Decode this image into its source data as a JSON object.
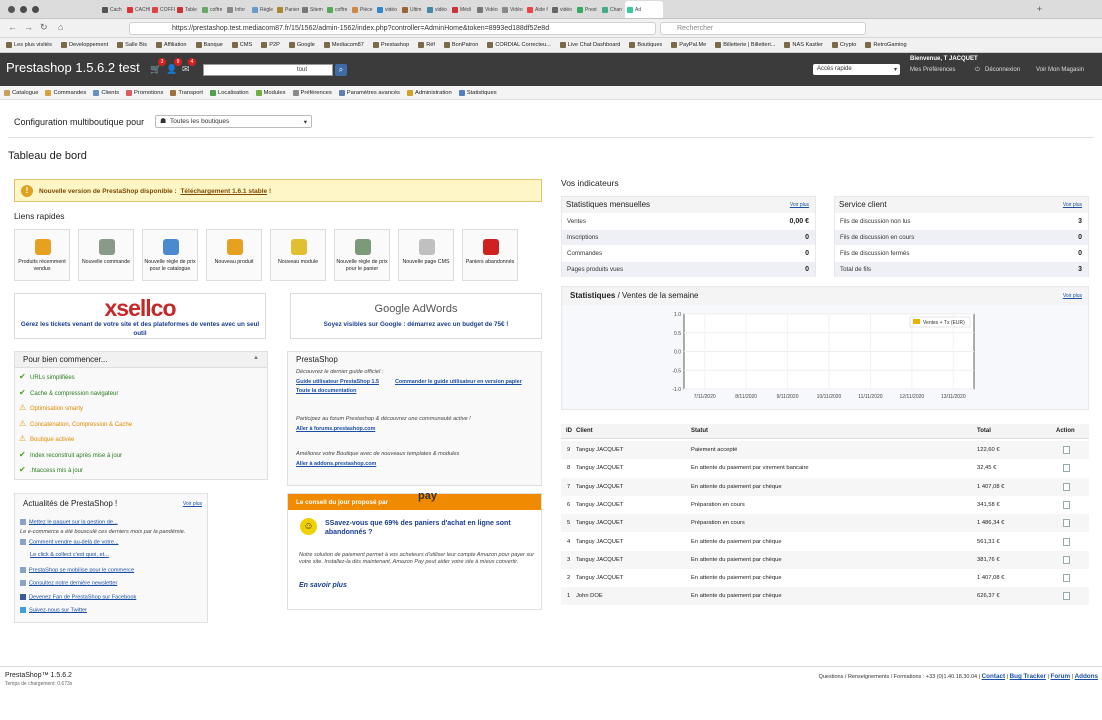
{
  "browser": {
    "tabs": [
      "Cach",
      "CACHE Cl",
      "COFFI",
      "Table",
      "coffre",
      "Infor",
      "Règle",
      "Panier",
      "Sitem",
      "coffre",
      "Pièce",
      "vidéo",
      "Ultim",
      "vidéo",
      "Médi",
      "Vidéo",
      "Vidéo",
      "Aide f",
      "vidéo",
      "Prest",
      "Chan",
      "Ad"
    ],
    "url": "https://prestashop.test.mediacom87.fr/15/1562/admin-1562/index.php?controller=AdminHome&token=8993ed188df52e8d",
    "search_placeholder": "Rechercher",
    "bookmarks": [
      "Les plus visités",
      "Developpement",
      "Salle Bis",
      "Affiliation",
      "Banque",
      "CMS",
      "P2P",
      "Google",
      "Mediacom87",
      "Prestashop",
      "Réf",
      "BonPatron",
      "CORDIAL Correcteu...",
      "Live Chat Dashboard",
      "Boutiques",
      "PayPal.Me",
      "Billetterie | Billetteri...",
      "NAS Kastler",
      "Crypto",
      "RetroGaming"
    ]
  },
  "header": {
    "title": "Prestashop 1.5.6.2 test",
    "cart_badges": [
      "3",
      "9",
      "4"
    ],
    "search_scope": "tout",
    "quick_access": "Accès rapide",
    "welcome": "Bienvenue, T JACQUET",
    "my_preferences": "Mes Préférences",
    "logout": "Déconnexion",
    "view_shop": "Voir Mon Magasin"
  },
  "menu": [
    {
      "label": "Catalogue",
      "color": "#c9a060"
    },
    {
      "label": "Commandes",
      "color": "#d8a040"
    },
    {
      "label": "Clients",
      "color": "#6a8fc0"
    },
    {
      "label": "Promotions",
      "color": "#d86060"
    },
    {
      "label": "Transport",
      "color": "#a07040"
    },
    {
      "label": "Localisation",
      "color": "#50a050"
    },
    {
      "label": "Modules",
      "color": "#70b040"
    },
    {
      "label": "Préférences",
      "color": "#8a8a8a"
    },
    {
      "label": "Paramètres avancés",
      "color": "#6080b0"
    },
    {
      "label": "Administration",
      "color": "#d0a030"
    },
    {
      "label": "Statistiques",
      "color": "#5080c0"
    }
  ],
  "config": {
    "label": "Configuration multiboutique pour",
    "shop": "Toutes les boutiques"
  },
  "page_title": "Tableau de bord",
  "alert": {
    "text": "Nouvelle version de PrestaShop disponible :",
    "link": "Téléchargement 1.6.1 stable",
    "suffix": "!"
  },
  "quick_links": {
    "title": "Liens rapides",
    "items": [
      {
        "label": "Produits récemment vendus",
        "color": "#e8a020"
      },
      {
        "label": "Nouvelle commande",
        "color": "#8a9a8a"
      },
      {
        "label": "Nouvelle règle de prix pour le catalogue",
        "color": "#4a8ad0"
      },
      {
        "label": "Nouveau produit",
        "color": "#e8a020"
      },
      {
        "label": "Nouveau module",
        "color": "#e0c030"
      },
      {
        "label": "Nouvelle règle de prix pour le panier",
        "color": "#7a9a7a"
      },
      {
        "label": "Nouvelle page CMS",
        "color": "#c0c0c0"
      },
      {
        "label": "Paniers abandonnés",
        "color": "#d02020"
      }
    ]
  },
  "xsellco": {
    "logo": "xsellco",
    "text": "Gérez les tickets venant de votre site et des plateformes de ventes avec un seul outil"
  },
  "adwords": {
    "logo": "Google AdWords",
    "text": "Soyez visibles sur Google : démarrez avec un budget de 75€ !"
  },
  "getting_started": {
    "title": "Pour bien commencer...",
    "items": [
      {
        "label": "URLs simplifiées",
        "status": "ok"
      },
      {
        "label": "Cache & compression navigateur",
        "status": "ok"
      },
      {
        "label": "Optimisation smarty",
        "status": "warn"
      },
      {
        "label": "Concaténation, Compression & Cache",
        "status": "warn"
      },
      {
        "label": "Boutique activée",
        "status": "warn"
      },
      {
        "label": "Index reconstruit après mise à jour",
        "status": "ok"
      },
      {
        "label": ".htaccess mis à jour",
        "status": "ok"
      }
    ]
  },
  "ps_box": {
    "title": "PrestaShop",
    "guide_text": "Découvrez le dernier guide officiel :",
    "guide_link1": "Guide utilisateur PrestaShop 1.5",
    "guide_link2": "Commander le guide utilisateur en version papier",
    "doc_link": "Toute la documentation",
    "forum_text": "Participez au forum Prestashop & découvrez une communauté active !",
    "forum_link": "Aller à forums.prestashop.com",
    "addons_text": "Améliorez votre Boutique avec de nouveaux templates & modules",
    "addons_link": "Aller à addons.prestashop.com"
  },
  "news": {
    "title": "Actualités de PrestaShop !",
    "more": "Voir plus",
    "link1": "Mettez le paquet sur la gestion de...",
    "text1": "Le e-commerce a été bousculé ces derniers mois par la pandémie.",
    "link2": "Comment vendre au-delà de votre...",
    "link3": "Le click & collect c'est quoi, et...",
    "link4": "PrestaShop se mobilise pour le commerce",
    "link5": "Consultez notre dernière newsletter",
    "link6": "Devenez Fan de PrestaShop sur Facebook",
    "link7": "Suivez-nous sur Twitter"
  },
  "tip": {
    "title": "Le conseil du jour proposé par",
    "brand": "pay",
    "main": "SSavez-vous que 69% des paniers d'achat en ligne sont abandonnés ?",
    "desc": "Notre solution de paiement permet à vos acheteurs d'utiliser leur compte Amazon pour payer sur votre site. Installez-la dès maintenant, Amazon Pay peut aider votre site à mieux convertir.",
    "more": "En savoir plus"
  },
  "indicators": {
    "title": "Vos indicateurs",
    "monthly": {
      "title": "Statistiques mensuelles",
      "more": "Voir plus",
      "rows": [
        {
          "label": "Ventes",
          "value": "0,00 €"
        },
        {
          "label": "Inscriptions",
          "value": "0"
        },
        {
          "label": "Commandes",
          "value": "0"
        },
        {
          "label": "Pages produits vues",
          "value": "0"
        }
      ]
    },
    "service": {
      "title": "Service client",
      "more": "Voir plus",
      "rows": [
        {
          "label": "Fils de discussion non lus",
          "value": "3"
        },
        {
          "label": "Fils de discussion en cours",
          "value": "0"
        },
        {
          "label": "Fils de discussion fermés",
          "value": "0"
        },
        {
          "label": "Total de fils",
          "value": "3"
        }
      ]
    }
  },
  "weekly": {
    "title_bold": "Statistiques",
    "title_rest": " / Ventes de la semaine",
    "more": "Voir plus"
  },
  "chart_data": {
    "type": "line",
    "title": "",
    "x": [
      "7/11/2020",
      "8/11/2020",
      "9/11/2020",
      "10/11/2020",
      "11/11/2020",
      "12/11/2020",
      "13/11/2020"
    ],
    "series": [
      {
        "name": "Ventes + Tx (EUR)",
        "values": [
          0,
          0,
          0,
          0,
          0,
          0,
          0
        ],
        "color": "#f0b000"
      }
    ],
    "ylim": [
      -1.0,
      1.0
    ],
    "yticks": [
      "1.0",
      "0.5",
      "0.0",
      "-0.5",
      "-1.0"
    ],
    "grid": true,
    "legend": "top-right"
  },
  "orders": {
    "headers": {
      "id": "ID",
      "client": "Client",
      "status": "Statut",
      "total": "Total",
      "action": "Action"
    },
    "rows": [
      {
        "id": "9",
        "client": "Tanguy JACQUET",
        "status": "Paiement accepté",
        "total": "122,60 €"
      },
      {
        "id": "8",
        "client": "Tanguy JACQUET",
        "status": "En attente du paiement par virement bancaire",
        "total": "32,45 €"
      },
      {
        "id": "7",
        "client": "Tanguy JACQUET",
        "status": "En attente du paiement par chèque",
        "total": "1 407,08 €"
      },
      {
        "id": "6",
        "client": "Tanguy JACQUET",
        "status": "Préparation en cours",
        "total": "341,58 €"
      },
      {
        "id": "5",
        "client": "Tanguy JACQUET",
        "status": "Préparation en cours",
        "total": "1 486,34 €"
      },
      {
        "id": "4",
        "client": "Tanguy JACQUET",
        "status": "En attente du paiement par chèque",
        "total": "561,31 €"
      },
      {
        "id": "3",
        "client": "Tanguy JACQUET",
        "status": "En attente du paiement par chèque",
        "total": "381,76 €"
      },
      {
        "id": "2",
        "client": "Tanguy JACQUET",
        "status": "En attente du paiement par chèque",
        "total": "1 407,08 €"
      },
      {
        "id": "1",
        "client": "John DOE",
        "status": "En attente du paiement par chèque",
        "total": "626,37 €"
      }
    ]
  },
  "footer": {
    "version": "PrestaShop™ 1.5.6.2",
    "load_time": "Temps de chargement: 0.673s",
    "contact_text": "Questions / Renseignements / Formations : +33 (0)1.40.18.30.04 |",
    "contact": "Contact",
    "bug": "Bug Tracker",
    "forum": "Forum",
    "addons": "Addons"
  },
  "colors": {
    "header_bg": "#3b3b3b",
    "link": "#1a4fa5",
    "alert_bg": "#fff6c8",
    "tip_orange": "#f08a00"
  }
}
